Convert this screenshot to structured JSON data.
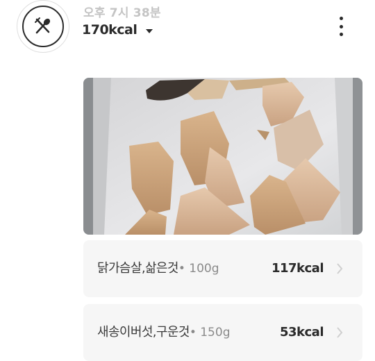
{
  "meal": {
    "time": "오후 7시 38분",
    "kcal_total": "170kcal",
    "icons": {
      "meal": "fork-spoon-icon",
      "dropdown": "caret-down-icon",
      "more": "more-vertical-icon"
    }
  },
  "photo": {
    "alt": ""
  },
  "foods": [
    {
      "name": "닭가슴살,삶은것",
      "amount": "• 100g",
      "kcal": "117kcal"
    },
    {
      "name": "새송이버섯,구운것",
      "amount": "• 150g",
      "kcal": "53kcal"
    }
  ],
  "colors": {
    "text": "#2a2a2a",
    "muted": "#c4c4c4",
    "card_bg": "#f6f6f6"
  }
}
